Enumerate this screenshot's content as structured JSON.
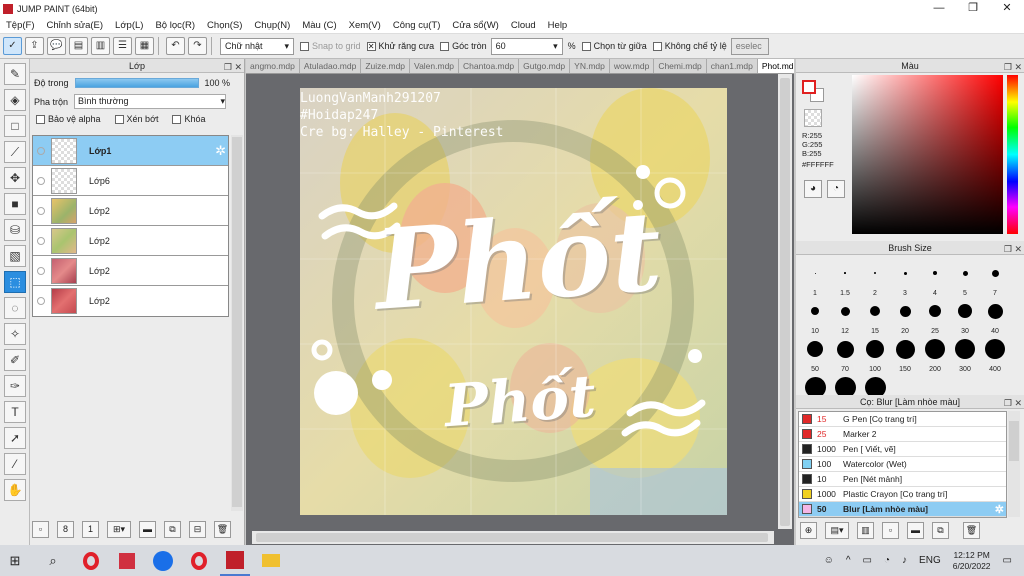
{
  "window": {
    "title": "JUMP PAINT (64bit)",
    "min": "—",
    "max": "❐",
    "close": "✕"
  },
  "menu": [
    "Tệp(F)",
    "Chỉnh sửa(E)",
    "Lớp(L)",
    "Bộ lọc(R)",
    "Chọn(S)",
    "Chụp(N)",
    "Màu (C)",
    "Xem(V)",
    "Công cụ(T)",
    "Cửa sổ(W)",
    "Cloud",
    "Help"
  ],
  "toolbar": {
    "shape_select": "Chữ nhật",
    "snap_grid": "Snap to grid",
    "antialias": "Khử răng cưa",
    "round_corner": "Góc tròn",
    "round_value": "60",
    "percent": "%",
    "select_center": "Chọn từ giữa",
    "no_ratio": "Không chế tỷ lệ",
    "deselect": "eselec"
  },
  "layer_panel": {
    "title": "Lớp",
    "opacity_label": "Độ trong",
    "opacity_value": "100 %",
    "blend_label": "Pha trộn",
    "blend_value": "Bình thường",
    "protect_alpha": "Bảo vệ alpha",
    "clip": "Xén bớt",
    "lock": "Khóa",
    "layers": [
      {
        "name": "Lớp1",
        "thumb": "checker",
        "selected": true
      },
      {
        "name": "Lớp6",
        "thumb": "checker",
        "selected": false
      },
      {
        "name": "Lớp2",
        "thumb": "img1",
        "selected": false
      },
      {
        "name": "Lớp2",
        "thumb": "img2",
        "selected": false
      },
      {
        "name": "Lớp2",
        "thumb": "img3",
        "selected": false
      },
      {
        "name": "Lớp2",
        "thumb": "img4",
        "selected": false
      }
    ]
  },
  "tabs": [
    "angmo.mdp",
    "Atuladao.mdp",
    "Zuize.mdp",
    "Valen.mdp",
    "Chantoa.mdp",
    "Gutgo.mdp",
    "YN.mdp",
    "wow.mdp",
    "Chemi.mdp",
    "chan1.mdp",
    "Phot.mdp"
  ],
  "active_tab": "Phot.mdp",
  "artwork": {
    "credit1": "LuongVanManh291207",
    "credit2": "#Hoidap247",
    "credit3": "Cre bg: Halley - Pinterest",
    "title_main": "Phốt",
    "title_sub": "Phốt"
  },
  "color_panel": {
    "title": "Màu",
    "r": "R:255",
    "g": "G:255",
    "b": "B:255",
    "hex": "#FFFFFF",
    "fg": "#ffffff",
    "bg": "#ffffff"
  },
  "brush_size": {
    "title": "Brush Size",
    "sizes": [
      "1",
      "1.5",
      "2",
      "3",
      "4",
      "5",
      "7",
      "10",
      "12",
      "15",
      "20",
      "25",
      "30",
      "40",
      "50",
      "70",
      "100",
      "150",
      "200",
      "300",
      "400",
      "",
      "",
      ""
    ]
  },
  "brush_list": {
    "title": "Cọ: Blur [Làm nhòe màu]",
    "items": [
      {
        "size": "15",
        "name": "G Pen [Cọ trang trí]",
        "color": "#e02828",
        "sizecolor": "#e02828",
        "selected": false
      },
      {
        "size": "25",
        "name": "Marker 2",
        "color": "#e02828",
        "sizecolor": "#e02828",
        "selected": false
      },
      {
        "size": "1000",
        "name": "Pen [ Viết, vẽ]",
        "color": "#222222",
        "sizecolor": "#222222",
        "selected": false
      },
      {
        "size": "100",
        "name": "Watercolor (Wet)",
        "color": "#7fd0f2",
        "sizecolor": "#222222",
        "selected": false
      },
      {
        "size": "10",
        "name": "Pen [Nét mảnh]",
        "color": "#222222",
        "sizecolor": "#222222",
        "selected": false
      },
      {
        "size": "1000",
        "name": "Plastic Crayon [Cọ trang trí]",
        "color": "#f0d020",
        "sizecolor": "#222222",
        "selected": false
      },
      {
        "size": "50",
        "name": "Blur [Làm nhòe màu]",
        "color": "#f4b6e6",
        "sizecolor": "#222222",
        "selected": true
      }
    ]
  },
  "taskbar": {
    "lang": "ENG",
    "time": "12:12 PM",
    "date": "6/20/2022"
  }
}
